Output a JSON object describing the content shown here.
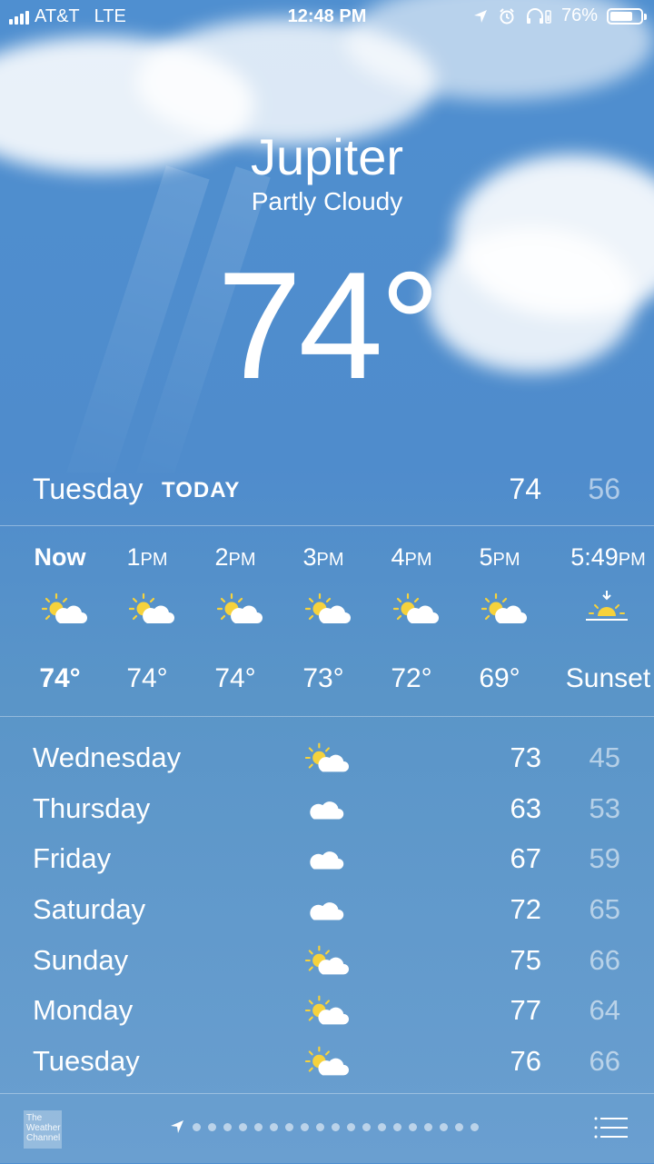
{
  "status_bar": {
    "carrier": "AT&T",
    "network": "LTE",
    "time": "12:48 PM",
    "battery": "76%",
    "battery_level": 0.76,
    "icons": [
      "location-arrow-icon",
      "alarm-icon",
      "headphones-icon",
      "battery-icon"
    ]
  },
  "location": {
    "city": "Jupiter",
    "condition": "Partly Cloudy",
    "temperature": "74°"
  },
  "today": {
    "day": "Tuesday",
    "label": "TODAY",
    "high": "74",
    "low": "56"
  },
  "hourly": [
    {
      "time": "Now",
      "suffix": "",
      "temp": "74°",
      "icon": "partly-cloudy-icon"
    },
    {
      "time": "1",
      "suffix": "PM",
      "temp": "74°",
      "icon": "partly-cloudy-icon"
    },
    {
      "time": "2",
      "suffix": "PM",
      "temp": "74°",
      "icon": "partly-cloudy-icon"
    },
    {
      "time": "3",
      "suffix": "PM",
      "temp": "73°",
      "icon": "partly-cloudy-icon"
    },
    {
      "time": "4",
      "suffix": "PM",
      "temp": "72°",
      "icon": "partly-cloudy-icon"
    },
    {
      "time": "5",
      "suffix": "PM",
      "temp": "69°",
      "icon": "partly-cloudy-icon"
    },
    {
      "time": "5:49",
      "suffix": "PM",
      "temp": "Sunset",
      "icon": "sunset-icon"
    }
  ],
  "daily": [
    {
      "day": "Wednesday",
      "icon": "partly-cloudy-icon",
      "high": "73",
      "low": "45"
    },
    {
      "day": "Thursday",
      "icon": "cloud-icon",
      "high": "63",
      "low": "53"
    },
    {
      "day": "Friday",
      "icon": "cloud-icon",
      "high": "67",
      "low": "59"
    },
    {
      "day": "Saturday",
      "icon": "cloud-icon",
      "high": "72",
      "low": "65"
    },
    {
      "day": "Sunday",
      "icon": "partly-cloudy-icon",
      "high": "75",
      "low": "66"
    },
    {
      "day": "Monday",
      "icon": "partly-cloudy-icon",
      "high": "77",
      "low": "64"
    },
    {
      "day": "Tuesday",
      "icon": "partly-cloudy-icon",
      "high": "76",
      "low": "66"
    }
  ],
  "footer": {
    "logo_text": "The Weather Channel",
    "page_count": 19,
    "colors": {
      "accent_sun": "#f6d23c"
    }
  }
}
